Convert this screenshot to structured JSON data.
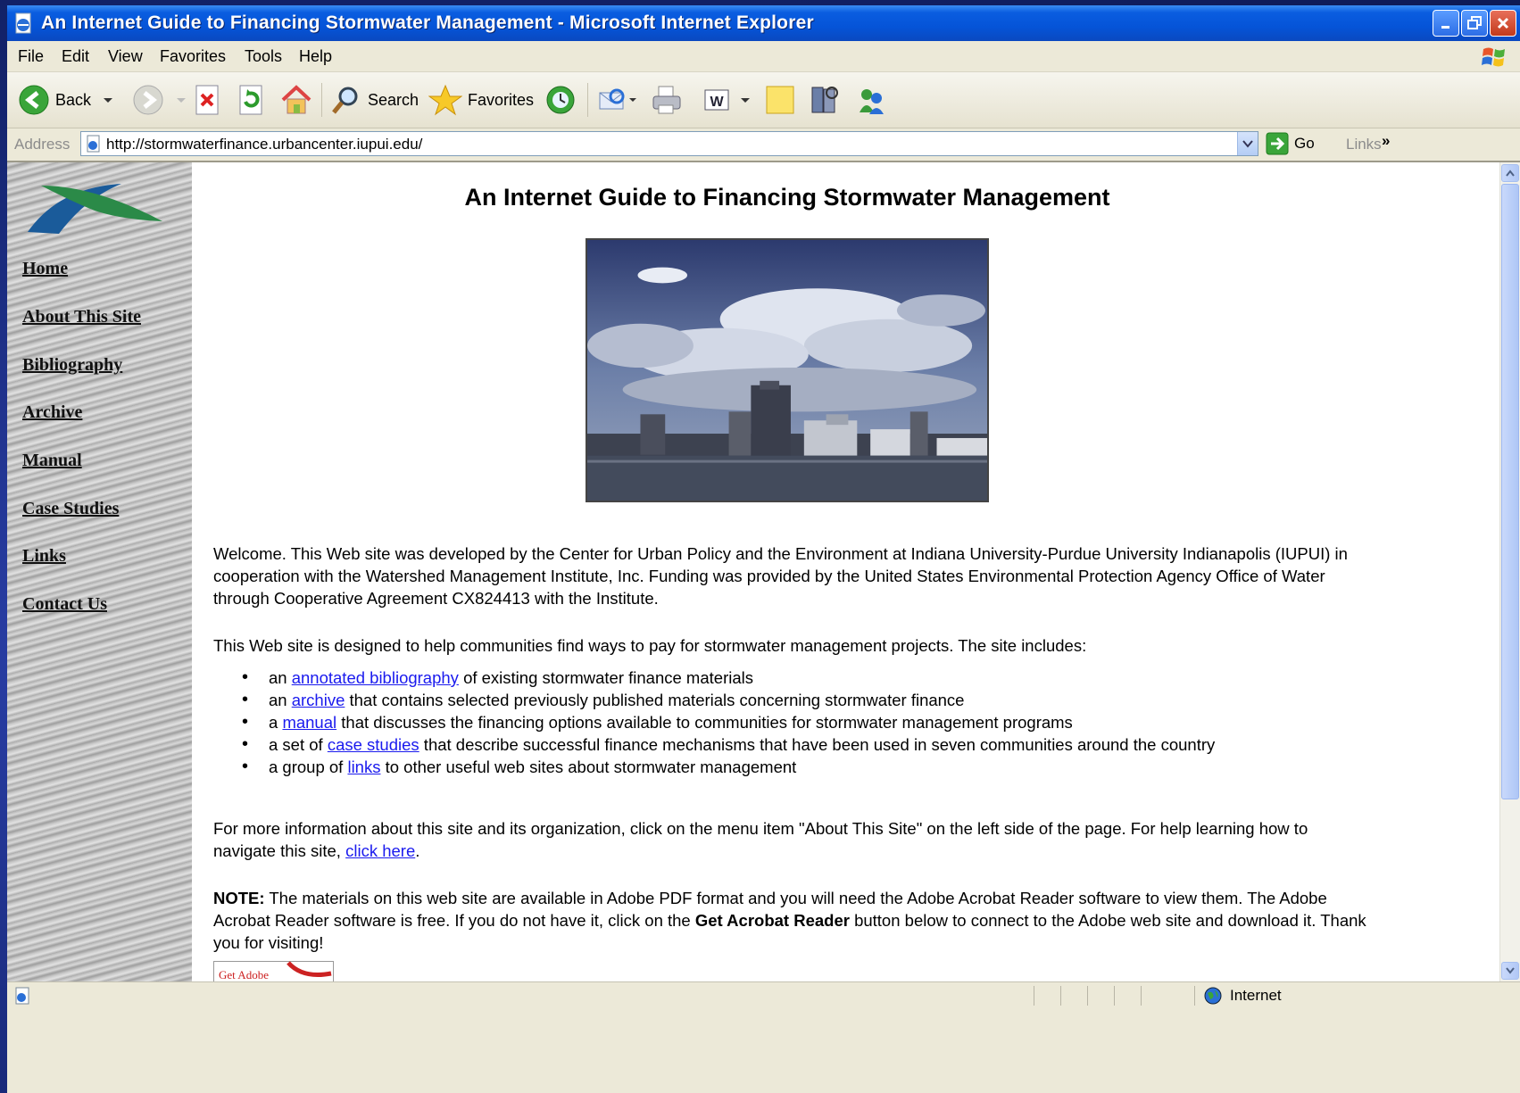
{
  "window": {
    "title": "An Internet Guide to Financing Stormwater Management - Microsoft Internet Explorer"
  },
  "menu": [
    "File",
    "Edit",
    "View",
    "Favorites",
    "Tools",
    "Help"
  ],
  "toolbar": {
    "back_label": "Back",
    "search_label": "Search",
    "favorites_label": "Favorites"
  },
  "address": {
    "label": "Address",
    "url": "http://stormwaterfinance.urbancenter.iupui.edu/",
    "go_label": "Go",
    "links_label": "Links",
    "more": "»"
  },
  "sidebar": {
    "items": [
      {
        "label": "Home"
      },
      {
        "label": "About This Site"
      },
      {
        "label": "Bibliography"
      },
      {
        "label": "Archive"
      },
      {
        "label": "Manual"
      },
      {
        "label": "Case Studies"
      },
      {
        "label": "Links"
      },
      {
        "label": "Contact Us"
      }
    ]
  },
  "main": {
    "title": "An Internet Guide to Financing Stormwater Management",
    "welcome": "Welcome. This Web site was developed by the Center for Urban Policy and the Environment at Indiana University-Purdue University Indianapolis (IUPUI) in cooperation with the Watershed Management Institute, Inc.  Funding was provided by the United States Environmental Protection Agency Office of Water through Cooperative Agreement CX824413 with the Institute.",
    "intro": "This Web site is designed to help communities find ways to pay for stormwater management projects.  The site includes:",
    "bullets": [
      {
        "pre": "an ",
        "link": "annotated bibliography",
        "post": " of existing stormwater finance materials"
      },
      {
        "pre": "an ",
        "link": "archive",
        "post": " that contains selected previously published materials concerning stormwater finance"
      },
      {
        "pre": "a ",
        "link": "manual",
        "post": " that discusses the financing options available to communities for stormwater management programs"
      },
      {
        "pre": "a set of ",
        "link": "case studies",
        "post": " that describe successful finance mechanisms that have been used in seven communities around the country"
      },
      {
        "pre": "a group of ",
        "link": "links",
        "post": " to other useful web sites about stormwater management"
      }
    ],
    "more_info_pre": "For more information about this site and its organization, click on the menu item \"About This Site\" on the left side of the page.  For help learning how to navigate this site, ",
    "more_info_link": "click here",
    "more_info_post": ".",
    "note_label": "NOTE:",
    "note_pre": " The materials on this web site are available in Adobe PDF format and you will need the Adobe Acrobat Reader software to view them.  The Adobe Acrobat Reader software is free.  If you do not have it, click on the ",
    "note_bold": "Get Acrobat Reader",
    "note_post": " button below to connect to the Adobe web site and download it. Thank you for visiting!",
    "acrobat_text": "Get Adobe"
  },
  "status": {
    "zone": "Internet"
  }
}
